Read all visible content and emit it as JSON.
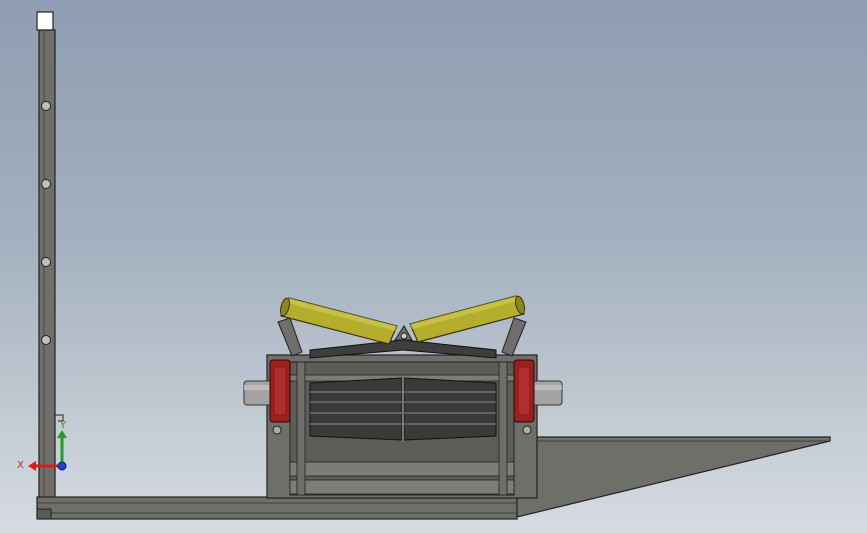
{
  "viewport": {
    "background_top": "#8e9db0",
    "background_bottom": "#d6dbe0"
  },
  "model": {
    "frame_color": "#6f6e6a",
    "roller_color": "#b4ad2e",
    "flange_color": "#9a1f1f",
    "impact_bar_color": "#3a3a3a"
  },
  "triad": {
    "x_label": "X",
    "y_label": "Y",
    "x_color": "#d02020",
    "y_color": "#20a020",
    "z_color": "#2040d0"
  }
}
